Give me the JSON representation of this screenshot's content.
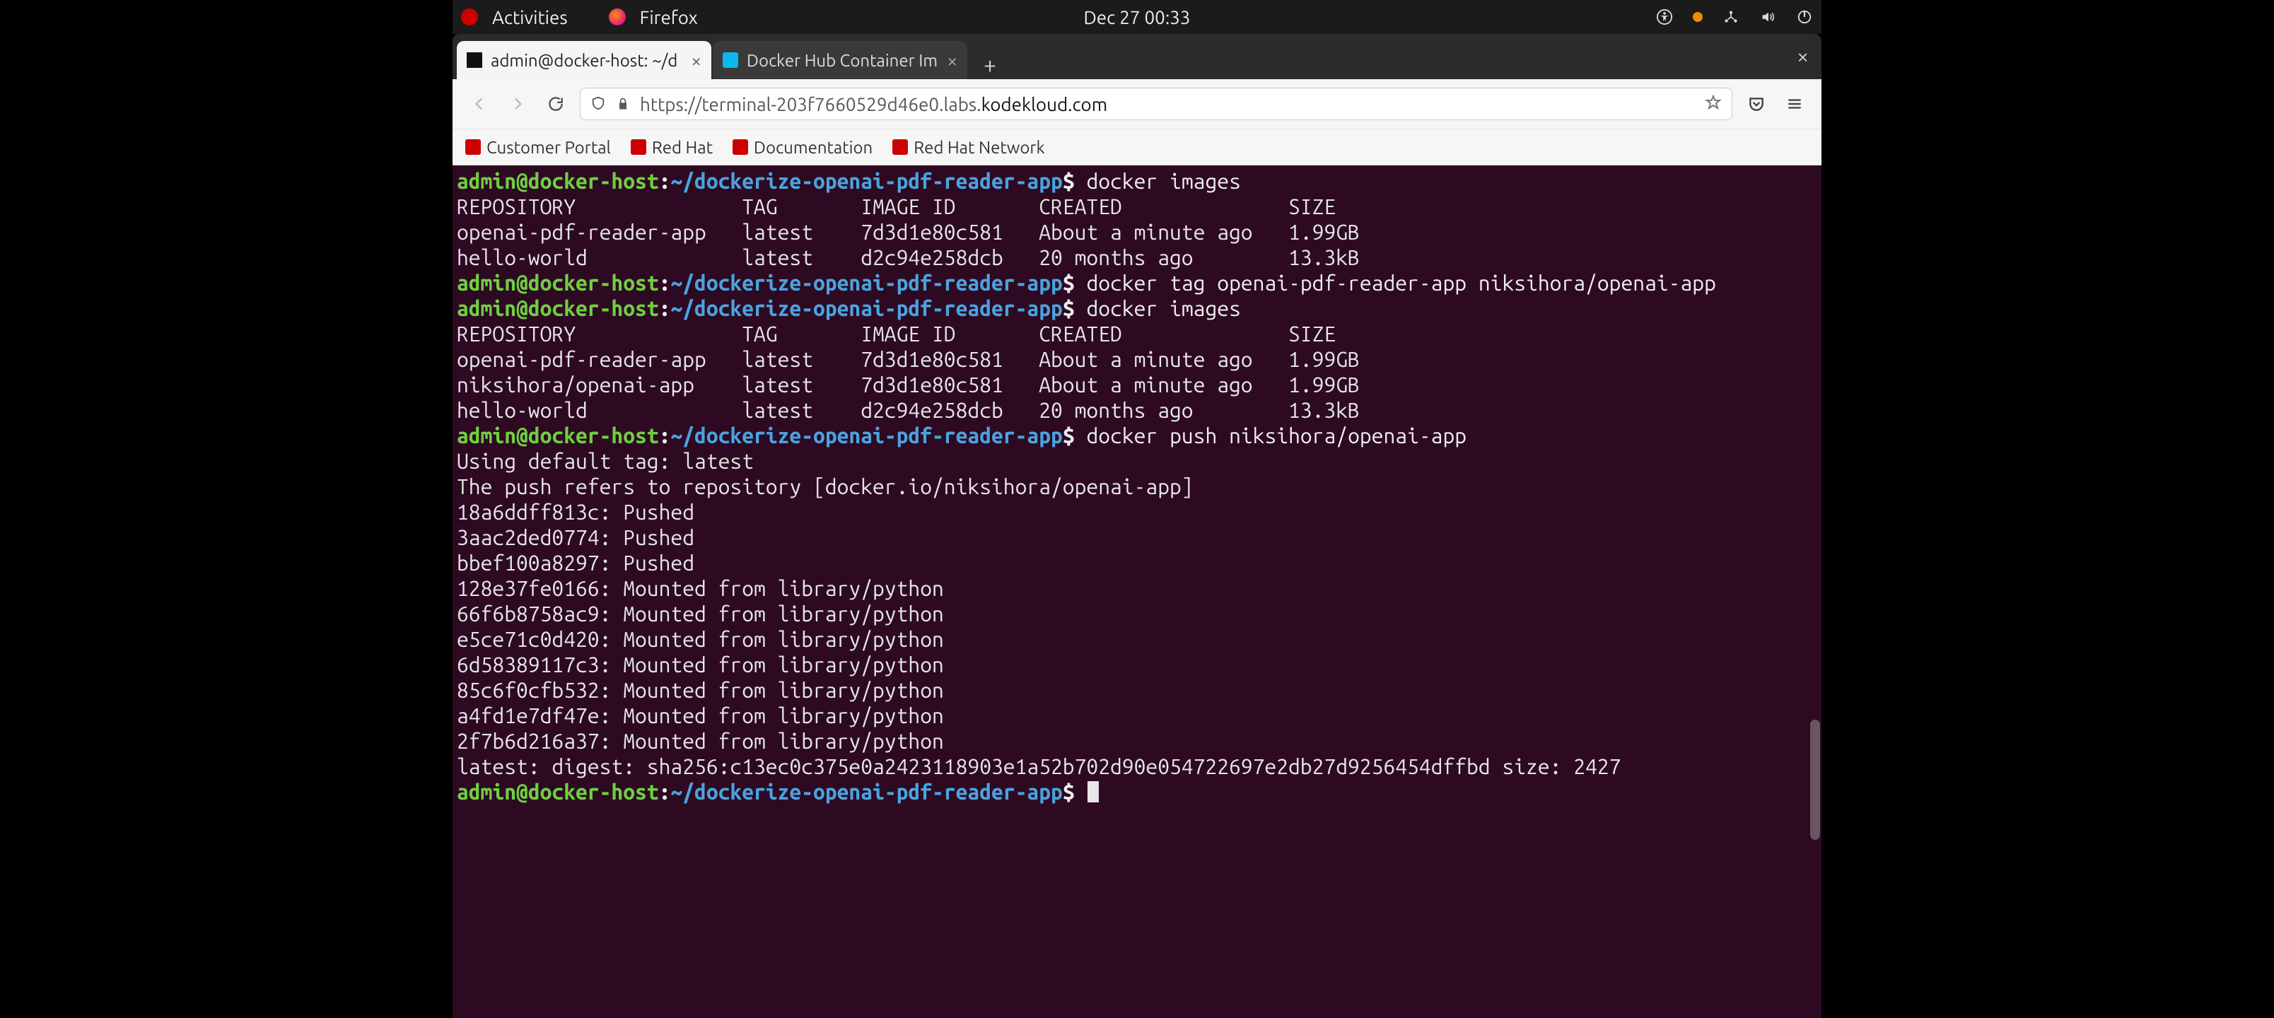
{
  "topbar": {
    "activities": "Activities",
    "app_name": "Firefox",
    "datetime": "Dec 27  00:33"
  },
  "tabs": [
    {
      "title": "admin@docker-host: ~/d",
      "active": true
    },
    {
      "title": "Docker Hub Container Im",
      "active": false
    }
  ],
  "url": {
    "scheme": "https://",
    "sub": "terminal-203f7660529d46e0.labs.",
    "main": "kodekloud.com"
  },
  "bookmarks": [
    {
      "label": "Customer Portal"
    },
    {
      "label": "Red Hat"
    },
    {
      "label": "Documentation"
    },
    {
      "label": "Red Hat Network"
    }
  ],
  "prompt": {
    "user": "admin",
    "host": "docker-host",
    "path": "~/dockerize-openai-pdf-reader-app",
    "symbol": "$"
  },
  "terminal": {
    "blocks": [
      {
        "cmd": "docker images",
        "out": [
          "REPOSITORY              TAG       IMAGE ID       CREATED              SIZE",
          "openai-pdf-reader-app   latest    7d3d1e80c581   About a minute ago   1.99GB",
          "hello-world             latest    d2c94e258dcb   20 months ago        13.3kB"
        ]
      },
      {
        "cmd": "docker tag openai-pdf-reader-app niksihora/openai-app",
        "out": []
      },
      {
        "cmd": "docker images",
        "out": [
          "REPOSITORY              TAG       IMAGE ID       CREATED              SIZE",
          "openai-pdf-reader-app   latest    7d3d1e80c581   About a minute ago   1.99GB",
          "niksihora/openai-app    latest    7d3d1e80c581   About a minute ago   1.99GB",
          "hello-world             latest    d2c94e258dcb   20 months ago        13.3kB"
        ]
      },
      {
        "cmd": "docker push niksihora/openai-app",
        "out": [
          "Using default tag: latest",
          "The push refers to repository [docker.io/niksihora/openai-app]",
          "18a6ddff813c: Pushed",
          "3aac2ded0774: Pushed",
          "bbef100a8297: Pushed",
          "128e37fe0166: Mounted from library/python",
          "66f6b8758ac9: Mounted from library/python",
          "e5ce71c0d420: Mounted from library/python",
          "6d58389117c3: Mounted from library/python",
          "85c6f0cfb532: Mounted from library/python",
          "a4fd1e7df47e: Mounted from library/python",
          "2f7b6d216a37: Mounted from library/python",
          "latest: digest: sha256:c13ec0c375e0a2423118903e1a52b702d90e054722697e2db27d9256454dffbd size: 2427"
        ]
      },
      {
        "cmd": "",
        "out": []
      }
    ]
  }
}
